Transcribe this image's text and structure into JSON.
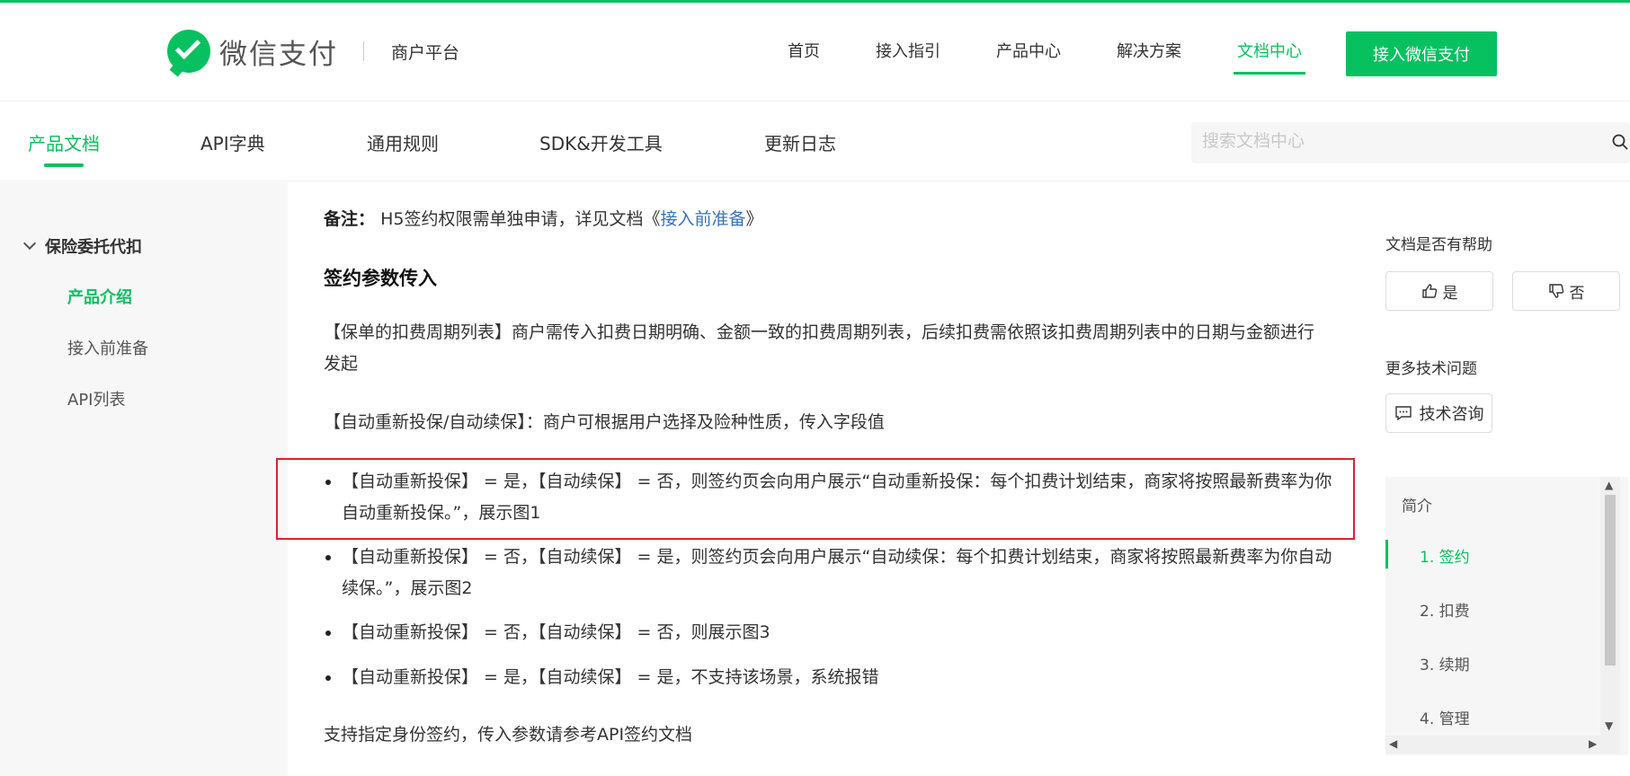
{
  "header": {
    "brand": "微信支付",
    "sub_brand": "商户平台",
    "nav": [
      "首页",
      "接入指引",
      "产品中心",
      "解决方案",
      "文档中心"
    ],
    "cta": "接入微信支付"
  },
  "subnav": {
    "items": [
      "产品文档",
      "API字典",
      "通用规则",
      "SDK&开发工具",
      "更新日志"
    ],
    "search_placeholder": "搜索文档中心"
  },
  "sidebar": {
    "group": "保险委托代扣",
    "items": [
      "产品介绍",
      "接入前准备",
      "API列表"
    ]
  },
  "content": {
    "note_label": "备注：",
    "note_text": "H5签约权限需单独申请，详见文档《",
    "note_link": "接入前准备",
    "note_end": "》",
    "heading": "签约参数传入",
    "para1": "【保单的扣费周期列表】商户需传入扣费日期明确、金额一致的扣费周期列表，后续扣费需依照该扣费周期列表中的日期与金额进行发起",
    "para2": "【自动重新投保/自动续保】：商户可根据用户选择及险种性质，传入字段值",
    "bullets": [
      "【自动重新投保】 = 是，【自动续保】 = 否，则签约页会向用户展示“自动重新投保：每个扣费计划结束，商家将按照最新费率为你自动重新投保。”，展示图1",
      "【自动重新投保】 = 否，【自动续保】 = 是，则签约页会向用户展示“自动续保：每个扣费计划结束，商家将按照最新费率为你自动续保。”，展示图2",
      "【自动重新投保】 = 否，【自动续保】 = 否，则展示图3",
      "【自动重新投保】 = 是，【自动续保】 = 是，不支持该场景，系统报错"
    ],
    "para3": "支持指定身份签约，传入参数请参考API签约文档"
  },
  "right": {
    "helpful_label": "文档是否有帮助",
    "yes": "是",
    "no": "否",
    "more_label": "更多技术问题",
    "consult": "技术咨询",
    "toc": [
      "简介",
      "1. 签约",
      "2. 扣费",
      "3. 续期",
      "4. 管理"
    ]
  },
  "colors": {
    "brand_green": "#07c160",
    "highlight_red": "#d9232d",
    "link_blue": "#3573b9"
  }
}
